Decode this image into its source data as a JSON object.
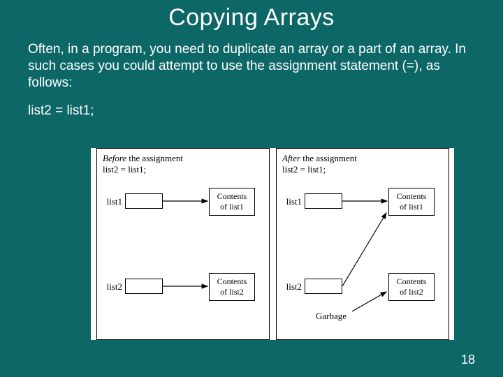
{
  "slide": {
    "title": "Copying Arrays",
    "paragraph": "Often, in a program, you need to duplicate an array or a part of an array. In such cases you could attempt to use the assignment statement (=), as follows:",
    "code": "list2 = list1;",
    "page_number": "18"
  },
  "diagram": {
    "left": {
      "caption_em": "Before",
      "caption_rest": " the assignment",
      "caption_line2": "list2 = list1;",
      "var1": "list1",
      "var2": "list2",
      "box1_line1": "Contents",
      "box1_line2": "of list1",
      "box2_line1": "Contents",
      "box2_line2": "of list2"
    },
    "right": {
      "caption_em": "After",
      "caption_rest": " the assignment",
      "caption_line2": "list2 = list1;",
      "var1": "list1",
      "var2": "list2",
      "garbage": "Garbage",
      "box1_line1": "Contents",
      "box1_line2": "of list1",
      "box2_line1": "Contents",
      "box2_line2": "of list2"
    }
  }
}
